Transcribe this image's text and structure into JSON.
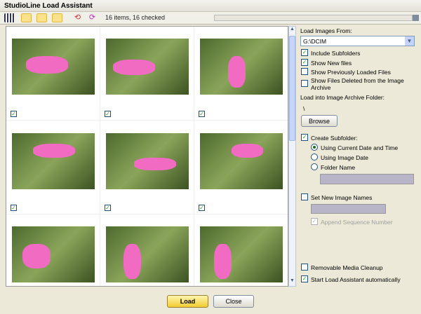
{
  "window": {
    "title": "StudioLine Load Assistant"
  },
  "toolbar": {
    "status": "16 items, 16 checked",
    "icons": [
      "grid-view-icon",
      "image-filter-icon",
      "audio-filter-icon",
      "video-filter-icon",
      "rotate-left-icon",
      "rotate-right-icon"
    ]
  },
  "thumbnails": [
    {
      "orientation": "rotated-right",
      "checked": true
    },
    {
      "orientation": "rotated-left",
      "checked": true
    },
    {
      "orientation": "portrait",
      "checked": true
    },
    {
      "orientation": "rotated-right",
      "checked": true
    },
    {
      "orientation": "rotated-left",
      "checked": true
    },
    {
      "orientation": "landscape",
      "checked": true
    },
    {
      "orientation": "landscape",
      "checked": true
    },
    {
      "orientation": "portrait",
      "checked": true
    },
    {
      "orientation": "portrait",
      "checked": true
    }
  ],
  "panel": {
    "load_from_label": "Load Images From:",
    "load_from_value": "G:\\DCIM",
    "include_subfolders": {
      "label": "Include Subfolders",
      "checked": true
    },
    "show_new": {
      "label": "Show New files",
      "checked": true
    },
    "show_previous": {
      "label": "Show Previously Loaded Files",
      "checked": false
    },
    "show_deleted": {
      "label1": "Show Files Deleted from the Image",
      "label2": "Archive",
      "checked": false
    },
    "archive_folder_label": "Load into Image Archive Folder:",
    "archive_folder_value": "\\",
    "browse": "Browse",
    "create_subfolder": {
      "label": "Create Subfolder:",
      "checked": true
    },
    "radio_current": "Using Current Date and Time",
    "radio_image_date": "Using Image Date",
    "radio_folder_name": "Folder Name",
    "set_names": {
      "label": "Set New Image Names",
      "checked": false
    },
    "append_seq": {
      "label": "Append Sequence Number",
      "checked": true
    },
    "removable_cleanup": {
      "label": "Removable Media Cleanup",
      "checked": false
    },
    "start_auto": {
      "label": "Start Load Assistant automatically",
      "checked": true
    }
  },
  "buttons": {
    "load": "Load",
    "close": "Close"
  }
}
